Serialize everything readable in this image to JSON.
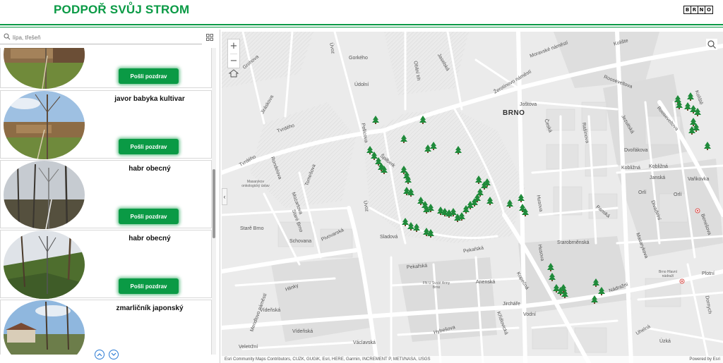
{
  "header": {
    "title": "PODPOŘ SVŮJ STROM",
    "logo_letters": [
      "B",
      "R",
      "N",
      "O"
    ]
  },
  "colors": {
    "accent": "#0a9a45",
    "map_bg": "#ececec",
    "road": "#ffffff",
    "tree": "#1f8a3a"
  },
  "sidebar": {
    "search": {
      "placeholder": "lípa, třešeň",
      "icon": "search-icon"
    },
    "view_toggle_icon": "grid-icon",
    "cards": [
      {
        "name": "",
        "button": "Pošli pozdrav",
        "photo": "photo-fortress-wall"
      },
      {
        "name": "javor babyka kultivar",
        "button": "Pošli pozdrav",
        "photo": "photo-fortress-wall"
      },
      {
        "name": "habr obecný",
        "button": "Pošli pozdrav",
        "photo": "photo-bare-trees"
      },
      {
        "name": "habr obecný",
        "button": "Pošli pozdrav",
        "photo": "photo-slope-trees"
      },
      {
        "name": "zmarličník japonský",
        "button": "Pošli pozdrav",
        "photo": "photo-house"
      }
    ],
    "pager": {
      "up_icon": "chevron-up-icon",
      "down_icon": "chevron-down-icon"
    }
  },
  "map": {
    "city_label": "BRNO",
    "zoom_in": "+",
    "zoom_out": "−",
    "home_icon": "home-icon",
    "search_icon": "search-icon",
    "collapse_icon": "chevron-left-icon",
    "labels": [
      "Grohova",
      "Úvoz",
      "Gorkého",
      "Jaselská",
      "Moravské náměstí",
      "Kolište",
      "Jiráskova",
      "Údolní",
      "Obilní trh",
      "Žerotínovo náměstí",
      "Joštova",
      "Rooseveltova",
      "Tvrdého",
      "Pellicova",
      "Špilberk",
      "Rooseveltova",
      "Česká",
      "Rašínova",
      "Jezuitská",
      "Dvořákova",
      "Koliště",
      "Kobližná",
      "Kobližná",
      "Janská",
      "Orlí",
      "Husova",
      "Rondelova",
      "Mozartova",
      "Tomešova",
      "Masarykov onkologický ústav",
      "Starě Brno",
      "Staré Brno",
      "Úvoz",
      "Sladová",
      "Pivovarská",
      "Pekařská",
      "Pekařská",
      "Anenská",
      "Kopečná",
      "Husova",
      "Starobrněnská",
      "Panská",
      "Masarykova",
      "Nádražní",
      "Divadelní",
      "Benešova",
      "Hlinky",
      "Vídeňská",
      "Vídeňská",
      "Veletržní",
      "Václavská",
      "Hybešova",
      "Vodní",
      "Křídlovická",
      "Jircháře",
      "Uhelná",
      "Úzká",
      "Dornych",
      "Plotní",
      "Brno Hlavní nádraží",
      "FN U Svaté Anny Brno",
      "Mendlovo náměstí",
      "Tvrdého",
      "Vaňkovka",
      "Orlí",
      "Schovana"
    ],
    "attribution": "Esri Community Maps Contributors, CUZK, GUGiK, Esri, HERE, Garmin, INCREMENT P, METI/NASA, USGS",
    "powered_by": "Powered by Esri",
    "tree_marker_icon": "tree-marker-icon"
  }
}
